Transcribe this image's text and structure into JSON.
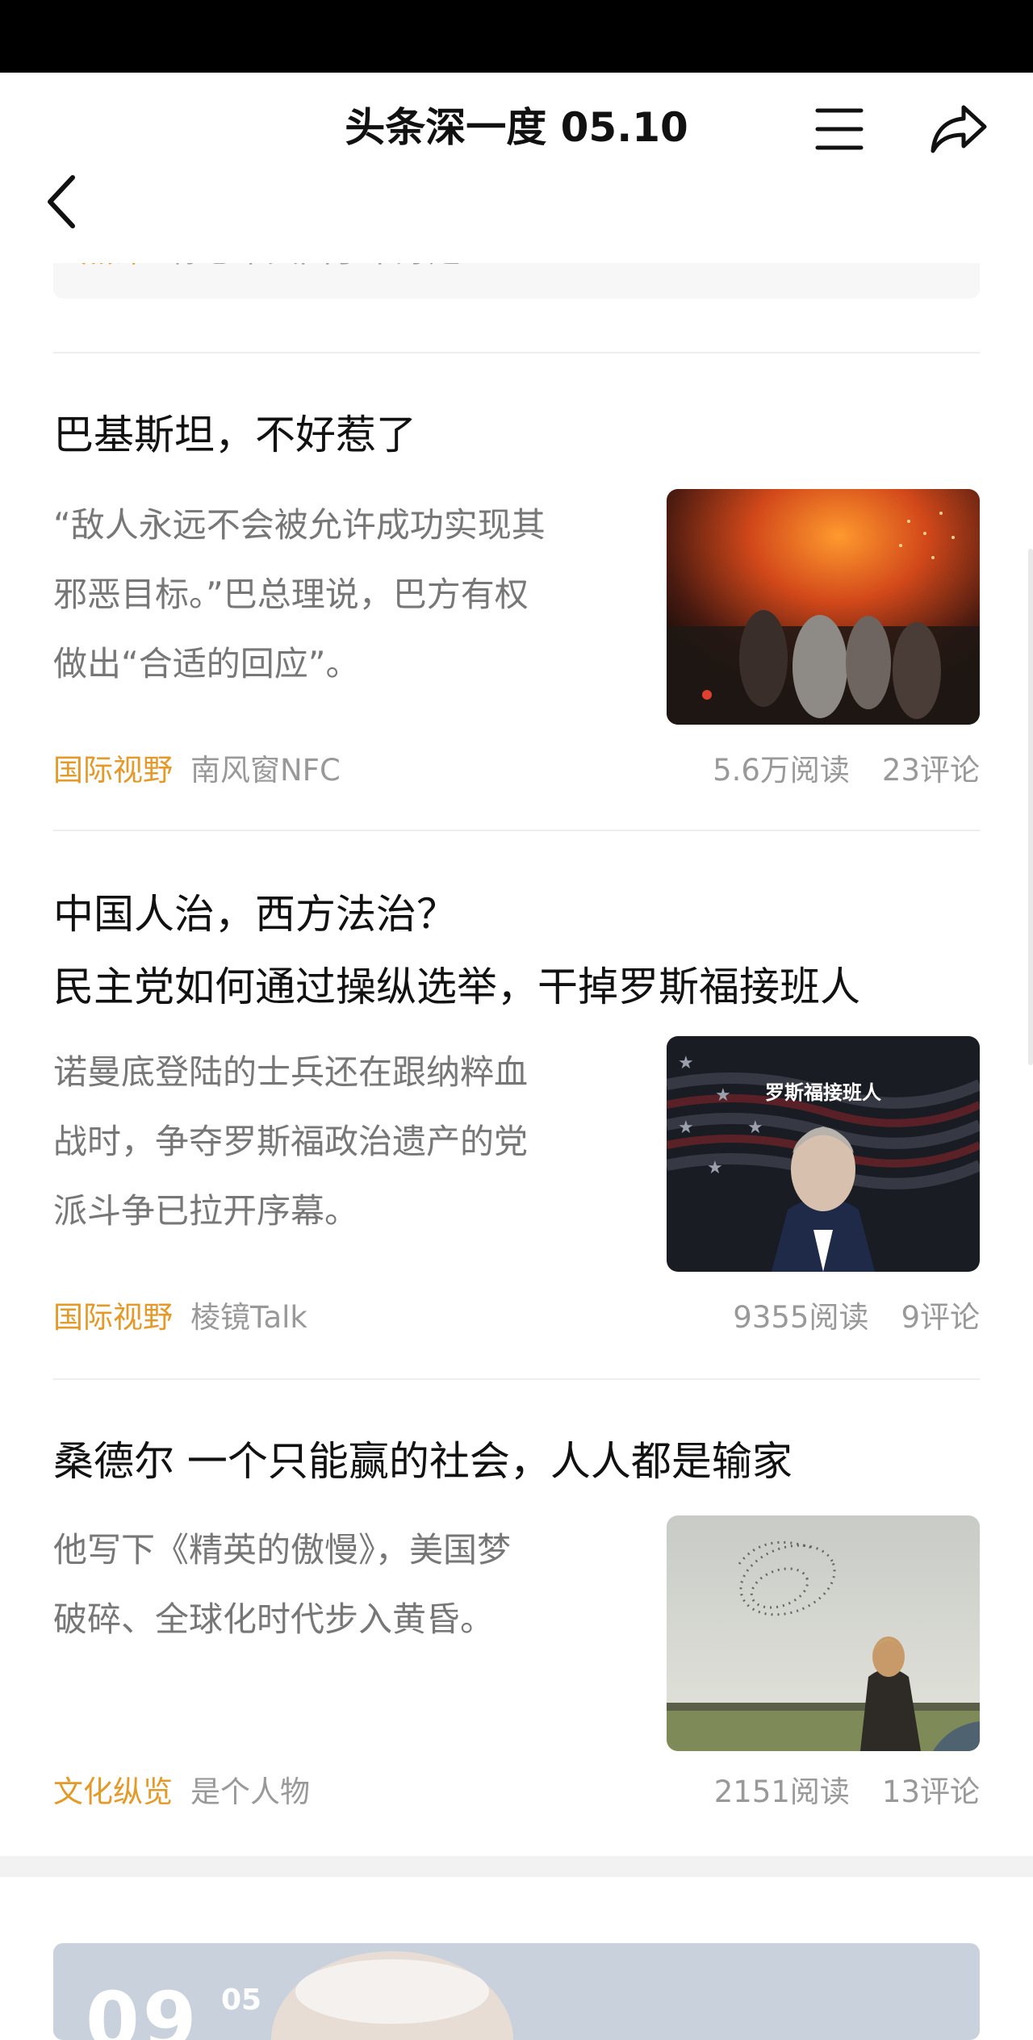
{
  "header": {
    "title": "头条深一度 05.10",
    "back_icon": "back-chevron-icon",
    "menu_icon": "menu-icon",
    "share_icon": "share-icon"
  },
  "peek_item": {
    "tag": "热评",
    "text": "祢心中大国了不好是"
  },
  "articles": [
    {
      "title": "巴基斯坦，不好惹了",
      "summary_lines": [
        "“敌人永远不会被允许成功实现其",
        "邪恶目标。”巴总理说，巴方有权",
        "做出“合适的回应”。"
      ],
      "tag": "国际视野",
      "source": "南风窗NFC",
      "reads": "5.6万阅读",
      "comments": "23评论"
    },
    {
      "title_lines": [
        "中国人治，西方法治？",
        "民主党如何通过操纵选举，干掉罗斯福接班人"
      ],
      "summary_lines": [
        "诺曼底登陆的士兵还在跟纳粹血",
        "战时，争夺罗斯福政治遗产的党",
        "派斗争已拉开序幕。"
      ],
      "image_caption": "罗斯福接班人",
      "tag": "国际视野",
      "source": "棱镜Talk",
      "reads": "9355阅读",
      "comments": "9评论"
    },
    {
      "title": "桑德尔 一个只能赢的社会，人人都是输家",
      "summary_lines": [
        "他写下《精英的傲慢》，美国梦",
        "破碎、全球化时代步入黄昏。"
      ],
      "tag": "文化纵览",
      "source": "是个人物",
      "reads": "2151阅读",
      "comments": "13评论"
    }
  ],
  "next_card": {
    "number": "09",
    "sub": "05"
  }
}
